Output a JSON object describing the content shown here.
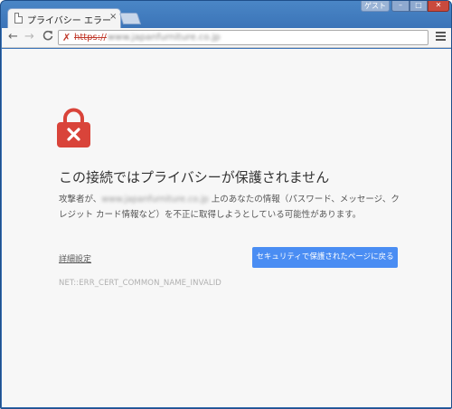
{
  "tab": {
    "title": "プライバシー エラー",
    "close": "×"
  },
  "window": {
    "guest_label": "ゲスト",
    "min": "–",
    "max": "□",
    "close": "✕"
  },
  "toolbar": {
    "back": "←",
    "forward": "→",
    "reload": "C",
    "lock_broken": "✗",
    "scheme": "https",
    "separator": "://",
    "host": "www.japanfurniture.co.jp"
  },
  "page": {
    "heading": "この接続ではプライバシーが保護されません",
    "explanation_prefix": "攻撃者が、",
    "explanation_host": "www.japanfurniture.co.jp",
    "explanation_suffix": " 上のあなたの情報（パスワード、メッセージ、クレジット カード情報など）を不正に取得しようとしている可能性があります。",
    "advanced_label": "詳細設定",
    "back_button_label": "セキュリティで保護されたページに戻る",
    "error_code": "NET::ERR_CERT_COMMON_NAME_INVALID"
  },
  "colors": {
    "accent": "#4a8df3",
    "lock_red": "#d9443a",
    "background": "#f7f7f7"
  }
}
